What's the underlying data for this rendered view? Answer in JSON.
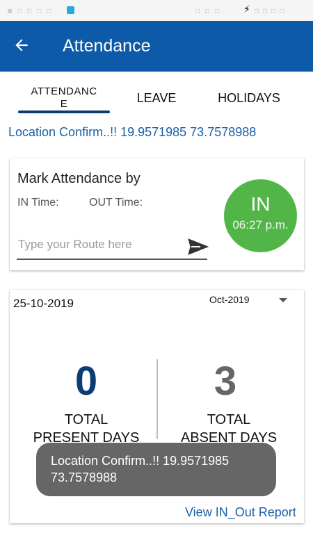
{
  "app_bar": {
    "title": "Attendance"
  },
  "tabs": [
    {
      "line1": "ATTENDANC",
      "line2": "E",
      "selected": true
    },
    {
      "label": "LEAVE",
      "selected": false
    },
    {
      "label": "HOLIDAYS",
      "selected": false
    }
  ],
  "location_text": "Location Confirm..!! 19.9571985 73.7578988",
  "mark_card": {
    "title": "Mark Attendance by",
    "in_time_label": "IN Time:",
    "out_time_label": "OUT Time:",
    "route_placeholder": "Type your Route here",
    "route_value": "",
    "in_button": {
      "label": "IN",
      "time": "06:27 p.m."
    }
  },
  "stats_card": {
    "date": "25-10-2019",
    "month_selected": "Oct-2019",
    "present": {
      "count": "0",
      "label_line1": "TOTAL",
      "label_line2": "PRESENT DAYS"
    },
    "absent": {
      "count": "3",
      "label_line1": "TOTAL",
      "label_line2": "ABSENT DAYS"
    },
    "report_link": "View IN_Out Report"
  },
  "toast": {
    "line1": "Location Confirm..!! 19.9571985",
    "line2": "73.7578988"
  },
  "colors": {
    "primary": "#0d5aa8",
    "accent_dark": "#0d3c74",
    "in_green": "#52b548",
    "link": "#1a5fa8"
  },
  "icons": {
    "back": "arrow-left-icon",
    "send": "send-icon",
    "dropdown": "caret-down-icon"
  }
}
